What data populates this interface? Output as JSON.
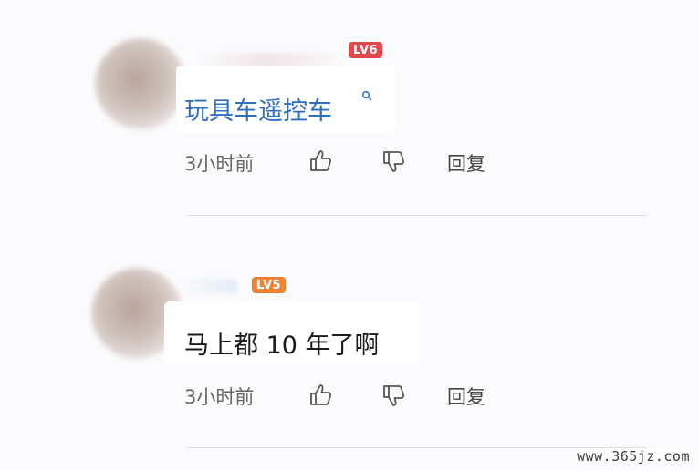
{
  "comments": [
    {
      "level_badge": "LV6",
      "badge_color": "#e5484d",
      "content": "玩具车遥控车",
      "content_color": "#2f6fbf",
      "time": "3小时前",
      "reply_label": "回复",
      "icons": [
        "thumbs-up-icon",
        "thumbs-down-icon",
        "search-icon"
      ]
    },
    {
      "level_badge": "LV5",
      "badge_color": "#f08434",
      "content": "马上都 10 年了啊",
      "time": "3小时前",
      "reply_label": "回复",
      "icons": [
        "thumbs-up-icon",
        "thumbs-down-icon"
      ]
    }
  ],
  "watermark": "www.365jz.com"
}
